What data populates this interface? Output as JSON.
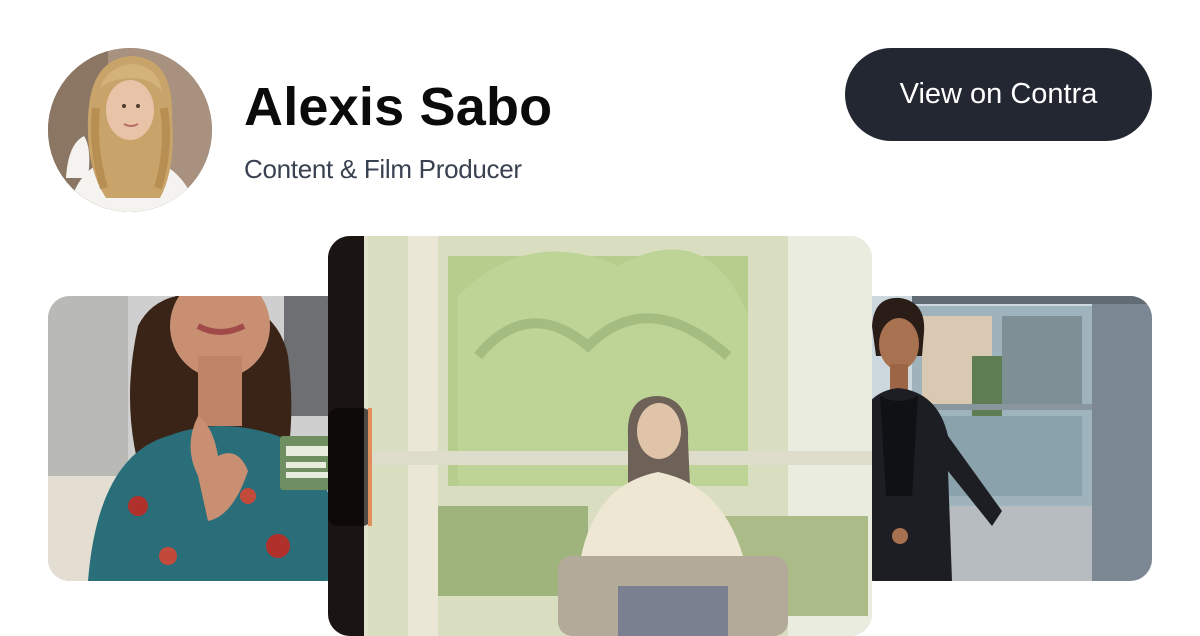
{
  "profile": {
    "name": "Alexis Sabo",
    "title": "Content & Film Producer",
    "avatar_alt": "Profile photo of Alexis Sabo"
  },
  "actions": {
    "view_label": "View on Contra"
  },
  "gallery": {
    "items": [
      {
        "alt": "Woman holding a Say Goodnight product box"
      },
      {
        "alt": "Film still of a woman seated by a garden window"
      },
      {
        "alt": "Woman in a black suit outside a glass building"
      }
    ]
  }
}
